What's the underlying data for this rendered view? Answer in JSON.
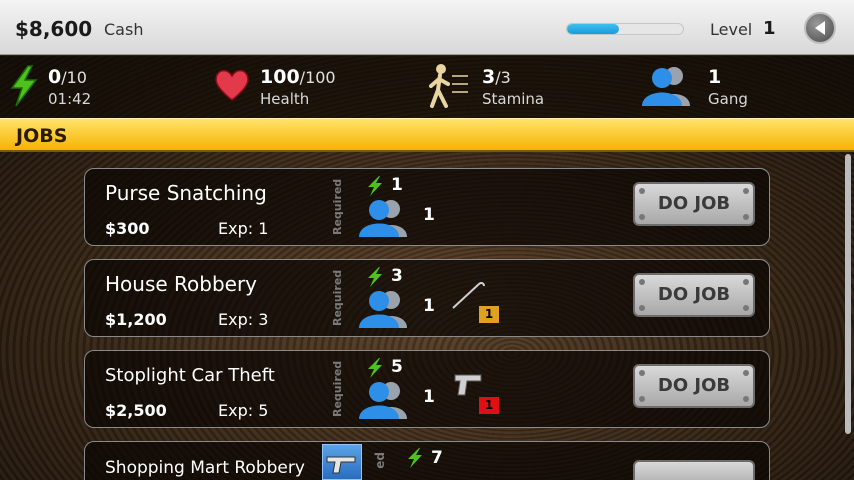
{
  "topbar": {
    "cash": "$8,600",
    "cash_label": "Cash",
    "level_label": "Level",
    "level": "1",
    "xp_progress": 0.45
  },
  "stats": {
    "energy": {
      "value": "0",
      "max": "/10",
      "timer": "01:42"
    },
    "health": {
      "value": "100",
      "max": "/100",
      "label": "Health"
    },
    "stamina": {
      "value": "3",
      "max": "/3",
      "label": "Stamina"
    },
    "gang": {
      "value": "1",
      "label": "Gang"
    }
  },
  "jobs_header": "JOBS",
  "required_label": "Required",
  "jobs": [
    {
      "name": "Purse Snatching",
      "pay": "$300",
      "exp": "Exp: 1",
      "energy": "1",
      "gang": "1",
      "button": "DO JOB"
    },
    {
      "name": "House Robbery",
      "pay": "$1,200",
      "exp": "Exp: 3",
      "energy": "3",
      "gang": "1",
      "item_count": "1",
      "button": "DO JOB"
    },
    {
      "name": "Stoplight Car Theft",
      "pay": "$2,500",
      "exp": "Exp: 5",
      "energy": "5",
      "gang": "1",
      "item_count": "1",
      "button": "DO JOB"
    },
    {
      "name": "Shopping Mart Robbery",
      "energy": "7",
      "required_partial": "ed"
    }
  ],
  "colors": {
    "accent": "#f5b400",
    "xp": "#1b9ad8",
    "item_owned": "#e0a020",
    "item_missing": "#e01010"
  },
  "icons": [
    "energy-bolt-icon",
    "heart-icon",
    "stamina-runner-icon",
    "gang-icon",
    "back-arrow-icon",
    "crowbar-icon",
    "pistol-icon"
  ]
}
